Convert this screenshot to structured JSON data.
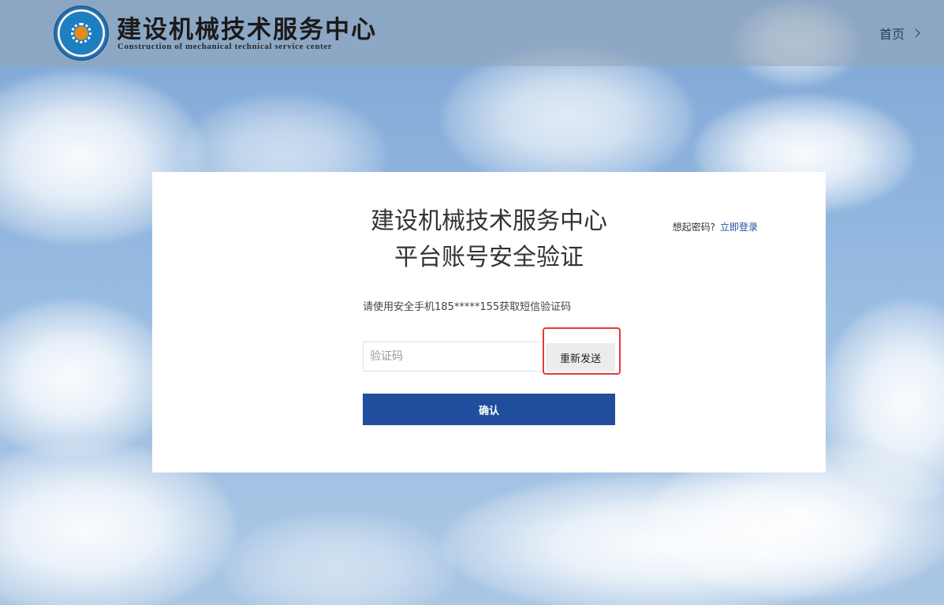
{
  "header": {
    "brand_title": "建设机械技术服务中心",
    "brand_subtitle": "Construction of mechanical technical service center",
    "nav_home": "首页",
    "logo_icon": "organization-logo-icon"
  },
  "card": {
    "title_line1": "建设机械技术服务中心",
    "title_line2": "平台账号安全验证",
    "login_prompt": "想起密码?",
    "login_link": "立即登录",
    "instruction": "请使用安全手机185*****155获取短信验证码",
    "code_placeholder": "验证码",
    "code_value": "",
    "resend_label": "重新发送",
    "confirm_label": "确认"
  },
  "colors": {
    "primary_button": "#214e9c",
    "link": "#1f4f9c",
    "highlight_border": "#e53935"
  }
}
